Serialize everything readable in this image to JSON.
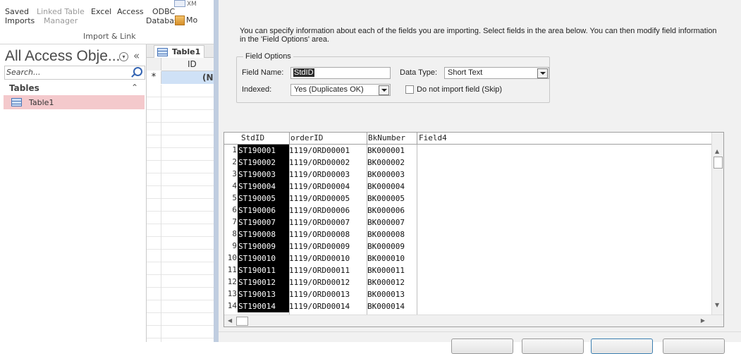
{
  "ribbon": {
    "saved_imports": [
      "Saved",
      "Imports"
    ],
    "linked_table_manager": [
      "Linked Table",
      "Manager"
    ],
    "excel": "Excel",
    "access": "Access",
    "odbc_database": [
      "ODBC",
      "Database"
    ],
    "xml_partial": "XM",
    "more_partial": "Mo",
    "group_label": "Import & Link"
  },
  "nav": {
    "title": "All Access Obje...",
    "search_placeholder": "Search...",
    "group": "Tables",
    "items": [
      {
        "label": "Table1"
      }
    ]
  },
  "datasheet": {
    "tab": "Table1",
    "column": "ID",
    "new_row_marker": "*",
    "new_value_partial": "(N"
  },
  "dialog": {
    "intro": "You can specify information about each of the fields you are importing. Select fields in the area below. You can then modify field information in the 'Field Options' area.",
    "field_options": {
      "legend": "Field Options",
      "field_name_label": "Field Name:",
      "field_name_value": "StdID",
      "data_type_label": "Data Type:",
      "data_type_value": "Short Text",
      "indexed_label": "Indexed:",
      "indexed_value": "Yes (Duplicates OK)",
      "skip_label": "Do not import field (Skip)",
      "skip_checked": false
    },
    "preview": {
      "headers": [
        "StdID",
        "orderID",
        "BkNumber",
        "Field4"
      ],
      "rows": [
        {
          "n": "1",
          "std": "ST190001",
          "ord": "1119/ORD00001",
          "bk": "BK000001"
        },
        {
          "n": "2",
          "std": "ST190002",
          "ord": "1119/ORD00002",
          "bk": "BK000002"
        },
        {
          "n": "3",
          "std": "ST190003",
          "ord": "1119/ORD00003",
          "bk": "BK000003"
        },
        {
          "n": "4",
          "std": "ST190004",
          "ord": "1119/ORD00004",
          "bk": "BK000004"
        },
        {
          "n": "5",
          "std": "ST190005",
          "ord": "1119/ORD00005",
          "bk": "BK000005"
        },
        {
          "n": "6",
          "std": "ST190006",
          "ord": "1119/ORD00006",
          "bk": "BK000006"
        },
        {
          "n": "7",
          "std": "ST190007",
          "ord": "1119/ORD00007",
          "bk": "BK000007"
        },
        {
          "n": "8",
          "std": "ST190008",
          "ord": "1119/ORD00008",
          "bk": "BK000008"
        },
        {
          "n": "9",
          "std": "ST190009",
          "ord": "1119/ORD00009",
          "bk": "BK000009"
        },
        {
          "n": "10",
          "std": "ST190010",
          "ord": "1119/ORD00010",
          "bk": "BK000010"
        },
        {
          "n": "11",
          "std": "ST190011",
          "ord": "1119/ORD00011",
          "bk": "BK000011"
        },
        {
          "n": "12",
          "std": "ST190012",
          "ord": "1119/ORD00012",
          "bk": "BK000012"
        },
        {
          "n": "13",
          "std": "ST190013",
          "ord": "1119/ORD00013",
          "bk": "BK000013"
        },
        {
          "n": "14",
          "std": "ST190014",
          "ord": "1119/ORD00014",
          "bk": "BK000014"
        }
      ]
    }
  }
}
